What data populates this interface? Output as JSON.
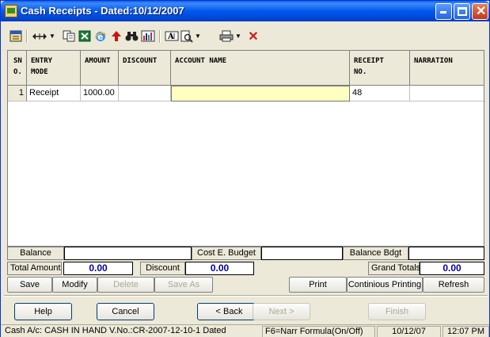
{
  "window": {
    "title": "Cash Receipts - Dated:10/12/2007"
  },
  "grid": {
    "headers": {
      "sno_1": "SN",
      "sno_2": "O.",
      "entry_mode_1": "ENTRY",
      "entry_mode_2": "MODE",
      "amount": "AMOUNT",
      "discount": "DISCOUNT",
      "account_name": "ACCOUNT NAME",
      "receipt_no_1": "RECEIPT",
      "receipt_no_2": "NO.",
      "narration": "NARRATION"
    },
    "rows": [
      {
        "sno": "1",
        "entry_mode": "Receipt",
        "amount": "1000.00",
        "discount": "",
        "account_name": "",
        "receipt_no": "48",
        "narration": ""
      }
    ]
  },
  "summary": {
    "balance_label": "Balance",
    "balance_value": "",
    "cost_budget_label": "Cost E. Budget",
    "cost_budget_value": "",
    "balance_bdgt_label": "Balance Bdgt",
    "balance_bdgt_value": "",
    "total_amount_label": "Total Amount",
    "total_amount_value": "0.00",
    "discount_label": "Discount",
    "discount_value": "0.00",
    "grand_totals_label": "Grand Totals",
    "grand_totals_value": "0.00"
  },
  "actions": {
    "save": "Save",
    "modify": "Modify",
    "delete": "Delete",
    "save_as": "Save As",
    "print": "Print",
    "continuous_printing": "Continious Printing",
    "refresh": "Refresh"
  },
  "wizard": {
    "help": "Help",
    "cancel": "Cancel",
    "back": "< Back",
    "next": "Next >",
    "finish": "Finish"
  },
  "statusbar": {
    "account": "Cash A/c: CASH IN HAND V.No.:CR-2007-12-10-1 Dated",
    "hint": "F6=Narr Formula(On/Off)",
    "date": "10/12/07",
    "time": "12:07 PM"
  },
  "colors": {
    "title_bar": "#0058ee",
    "active_cell": "#ffffc0",
    "totals_text": "#0000a0"
  }
}
